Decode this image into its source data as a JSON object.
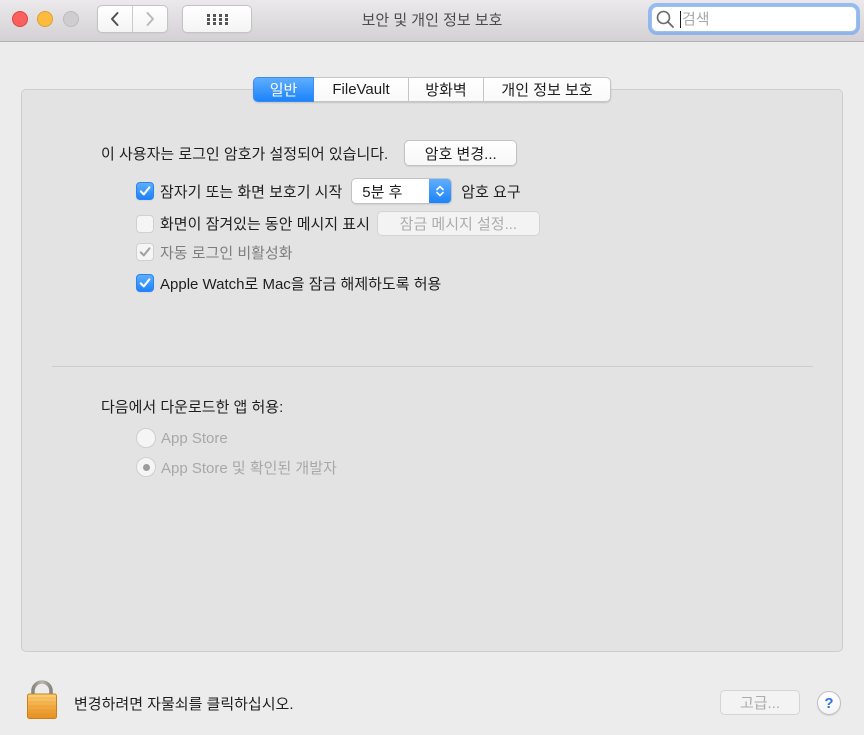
{
  "window": {
    "title": "보안 및 개인 정보 보호",
    "zoom_disabled": true,
    "search_placeholder": "검색"
  },
  "toolbar": {
    "back_disabled": false,
    "forward_disabled": true
  },
  "tabs": [
    {
      "label": "일반",
      "selected": true
    },
    {
      "label": "FileVault",
      "selected": false
    },
    {
      "label": "방화벽",
      "selected": false
    },
    {
      "label": "개인 정보 보호",
      "selected": false
    }
  ],
  "general": {
    "password_status": "이 사용자는 로그인 암호가 설정되어 있습니다.",
    "change_password_label": "암호 변경...",
    "require_password": {
      "label": "잠자기 또는 화면 보호기 시작",
      "checked": true,
      "disabled": false,
      "delay_selected": "5분 후",
      "suffix": "암호 요구"
    },
    "lock_message": {
      "label": "화면이 잠겨있는 동안 메시지 표시",
      "checked": false,
      "disabled": true,
      "button_label": "잠금 메시지 설정...",
      "button_disabled": true
    },
    "disable_auto_login": {
      "label": "자동 로그인 비활성화",
      "checked": true,
      "disabled": true
    },
    "apple_watch_unlock": {
      "label": "Apple Watch로 Mac을 잠금 해제하도록 허용",
      "checked": true,
      "disabled": false
    },
    "allow_apps": {
      "heading": "다음에서 다운로드한 앱 허용:",
      "options": [
        {
          "label": "App Store",
          "selected": false,
          "disabled": true
        },
        {
          "label": "App Store 및 확인된 개발자",
          "selected": true,
          "disabled": true
        }
      ]
    }
  },
  "footer": {
    "lock_text": "변경하려면 자물쇠를 클릭하십시오.",
    "advanced_label": "고급...",
    "advanced_disabled": true,
    "help_label": "?"
  },
  "icons": {
    "back": "chevron-left-icon",
    "forward": "chevron-right-icon",
    "show_all": "grid-icon",
    "search": "search-icon",
    "popup_stepper": "up-down-chevron-icon",
    "checkbox_mark": "checkmark-icon",
    "lock": "lock-closed-icon"
  },
  "colors": {
    "accent": "#1b83fb",
    "accent_light": "#5eaefd",
    "close_button": "#fc605c",
    "minimize_button": "#fdbc40",
    "zoom_button_disabled": "#cecece",
    "window_background": "#ececec",
    "panel_background": "#e3e3e3",
    "disabled_text": "#a8a8a8",
    "lock": "#f2ab43",
    "help_icon": "#2f72dc"
  }
}
